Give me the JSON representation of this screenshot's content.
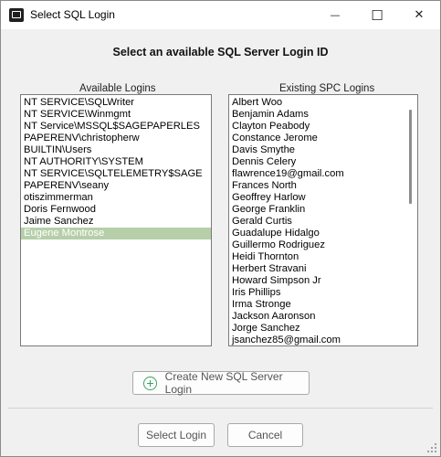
{
  "window": {
    "title": "Select SQL Login",
    "minimize_glyph": "—",
    "maximize_glyph": "☐",
    "close_glyph": "✕"
  },
  "heading": "Select an available SQL Server Login ID",
  "available": {
    "label": "Available Logins",
    "items": [
      "NT SERVICE\\SQLWriter",
      "NT SERVICE\\Winmgmt",
      "NT Service\\MSSQL$SAGEPAPERLES",
      "PAPERENV\\christopherw",
      "BUILTIN\\Users",
      "NT AUTHORITY\\SYSTEM",
      "NT SERVICE\\SQLTELEMETRY$SAGE",
      "PAPERENV\\seany",
      "otiszimmerman",
      "Doris Fernwood",
      "Jaime Sanchez",
      "Eugene Montrose"
    ],
    "selected_index": 11
  },
  "existing": {
    "label": "Existing SPC Logins",
    "items": [
      "Albert Woo",
      "Benjamin Adams",
      "Clayton Peabody",
      "Constance Jerome",
      "Davis Smythe",
      "Dennis Celery",
      "flawrence19@gmail.com",
      "Frances North",
      "Geoffrey Harlow",
      "George Franklin",
      "Gerald Curtis",
      "Guadalupe Hidalgo",
      "Guillermo Rodriguez",
      "Heidi Thornton",
      "Herbert Stravani",
      "Howard Simpson Jr",
      "Iris Phillips",
      "Irma Stronge",
      "Jackson Aaronson",
      "Jorge Sanchez",
      "jsanchez85@gmail.com"
    ]
  },
  "buttons": {
    "create": "Create New SQL Server Login",
    "select": "Select Login",
    "cancel": "Cancel"
  },
  "colors": {
    "selection": "#b6cfa9",
    "plus_icon": "#3aa35c"
  }
}
